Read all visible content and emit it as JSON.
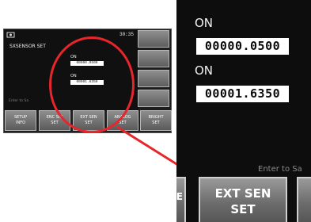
{
  "screen": {
    "page_indicator": "30:35",
    "title": "SXSENSOR SET",
    "status_hint": "Enter to Sa",
    "sensor_1": {
      "state": "ON",
      "value": "00000.0500"
    },
    "sensor_2": {
      "state": "ON",
      "value": "00001.6350"
    },
    "bottom_buttons": [
      {
        "label": "SETUP\nINFO"
      },
      {
        "label": "ENC SIG\nSET"
      },
      {
        "label": "EXT SEN\nSET"
      },
      {
        "label": "ANALOG\nSET"
      },
      {
        "label": "BRIGHT\nSET"
      }
    ],
    "zoom_button": {
      "line1": "EXT SEN",
      "line2": "SET"
    }
  },
  "colors": {
    "highlight_ring": "#e6262b",
    "screen_bg": "#0d0d0d",
    "button_face": "#7a7a7a"
  }
}
